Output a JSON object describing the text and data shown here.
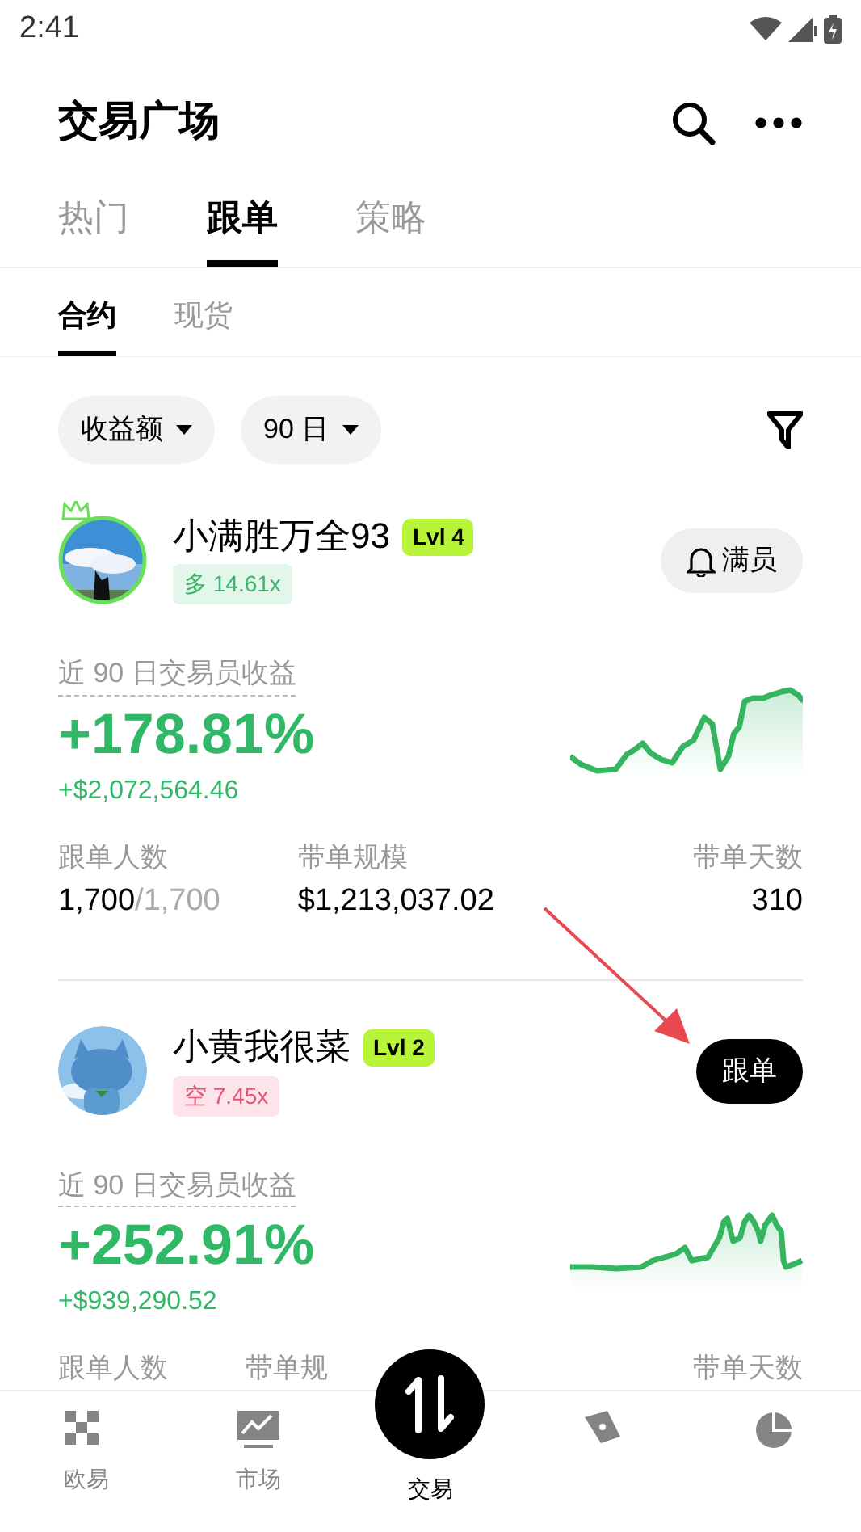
{
  "status_bar": {
    "time": "2:41"
  },
  "header": {
    "title": "交易广场"
  },
  "tabs": [
    {
      "label": "热门",
      "selected": false
    },
    {
      "label": "跟单",
      "selected": true
    },
    {
      "label": "策略",
      "selected": false
    }
  ],
  "subtabs": [
    {
      "label": "合约",
      "selected": true
    },
    {
      "label": "现货",
      "selected": false
    }
  ],
  "filters": [
    {
      "label": "收益额"
    },
    {
      "label": "90 日"
    }
  ],
  "traders": [
    {
      "name": "小满胜万全93",
      "level": "Lvl 4",
      "crown": true,
      "position": {
        "kind": "long",
        "label": "多 14.61x"
      },
      "action": {
        "kind": "full",
        "label": "满员"
      },
      "return_label": "近 90 日交易员收益",
      "return_pct": "+178.81%",
      "return_amount": "+$2,072,564.46",
      "stats": [
        {
          "label": "跟单人数",
          "value": "1,700",
          "total": "/1,700"
        },
        {
          "label": "带单规模",
          "value": "$1,213,037.02"
        },
        {
          "label": "带单天数",
          "value": "310"
        }
      ]
    },
    {
      "name": "小黄我很菜",
      "level": "Lvl 2",
      "crown": false,
      "position": {
        "kind": "short",
        "label": "空 7.45x"
      },
      "action": {
        "kind": "follow",
        "label": "跟单"
      },
      "return_label": "近 90 日交易员收益",
      "return_pct": "+252.91%",
      "return_amount": "+$939,290.52",
      "stats": [
        {
          "label": "跟单人数"
        },
        {
          "label": "带单规"
        },
        {
          "label": "带单天数"
        }
      ]
    }
  ],
  "annotation": {
    "kind": "arrow"
  },
  "nav": [
    {
      "label": "欧易",
      "kind": "grid",
      "selected": false
    },
    {
      "label": "市场",
      "kind": "chart",
      "selected": false
    },
    {
      "label": "交易",
      "kind": "center",
      "selected": true
    },
    {
      "kind": "compass",
      "selected": false
    },
    {
      "kind": "pie",
      "selected": false
    }
  ]
}
